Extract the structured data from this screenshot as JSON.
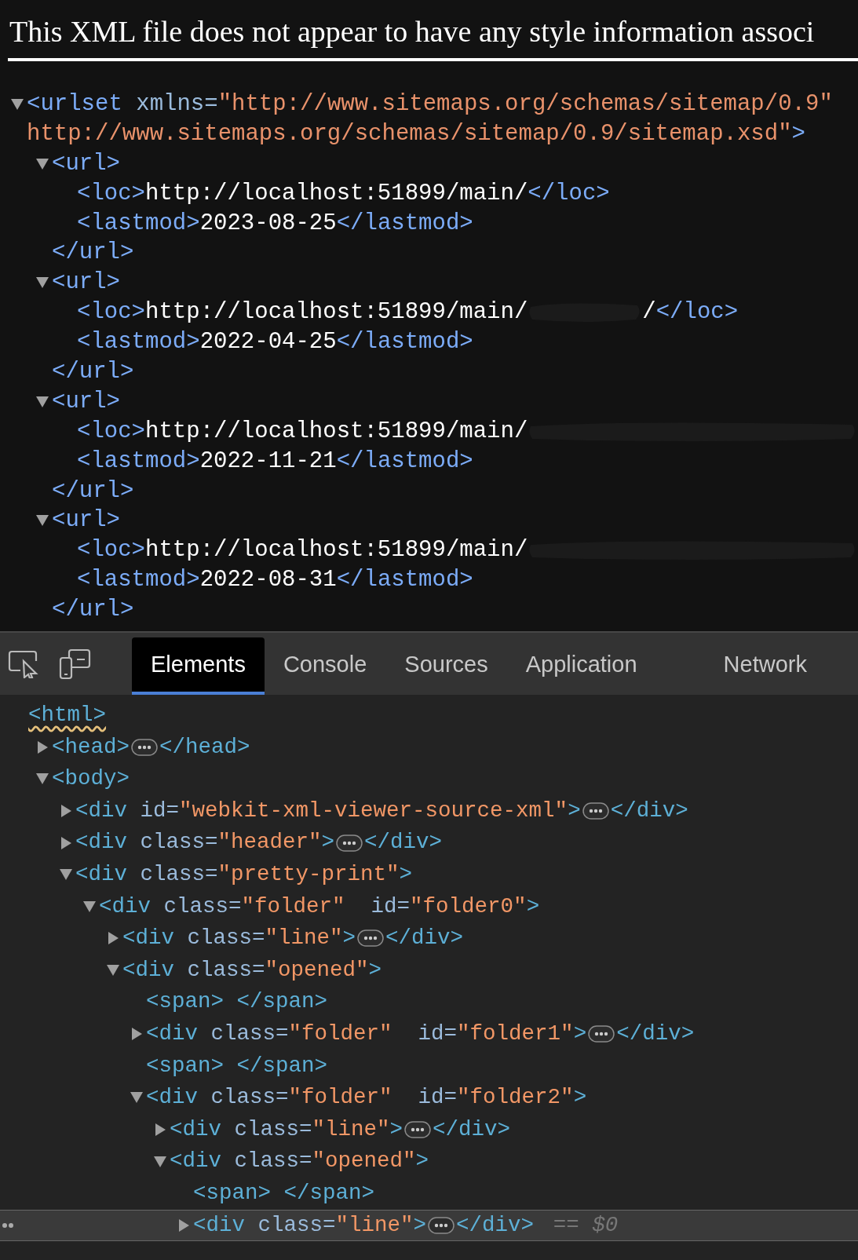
{
  "xml_viewer": {
    "notice": "This XML file does not appear to have any style information associ",
    "tree": {
      "expanded": true,
      "open": [
        {
          "kind": "tag",
          "text": "<urlset"
        },
        {
          "kind": "attr",
          "text": " xmlns="
        },
        {
          "kind": "value",
          "text": "\"http://www.sitemaps.org/schemas/sitemap/0.9\""
        }
      ],
      "open_continued": [
        {
          "kind": "value",
          "text": "http://www.sitemaps.org/schemas/sitemap/0.9/sitemap.xsd\""
        },
        {
          "kind": "tag",
          "text": ">"
        }
      ],
      "children": [
        {
          "expanded": true,
          "open": [
            {
              "kind": "tag",
              "text": "<url>"
            }
          ],
          "close": [
            {
              "kind": "tag",
              "text": "</url>"
            }
          ],
          "children": [
            {
              "open": [
                {
                  "kind": "tag",
                  "text": "<loc>"
                },
                {
                  "kind": "text",
                  "text": "http://localhost:51899/main/"
                },
                {
                  "kind": "tag",
                  "text": "</loc>"
                }
              ]
            },
            {
              "open": [
                {
                  "kind": "tag",
                  "text": "<lastmod>"
                },
                {
                  "kind": "text",
                  "text": "2023-08-25"
                },
                {
                  "kind": "tag",
                  "text": "</lastmod>"
                }
              ]
            }
          ]
        },
        {
          "expanded": true,
          "open": [
            {
              "kind": "tag",
              "text": "<url>"
            }
          ],
          "close": [
            {
              "kind": "tag",
              "text": "</url>"
            }
          ],
          "children": [
            {
              "open": [
                {
                  "kind": "tag",
                  "text": "<loc>"
                },
                {
                  "kind": "text",
                  "text": "http://localhost:51899/main/"
                },
                {
                  "kind": "redacted"
                },
                {
                  "kind": "text",
                  "text": "/"
                },
                {
                  "kind": "tag",
                  "text": "</loc>"
                }
              ]
            },
            {
              "open": [
                {
                  "kind": "tag",
                  "text": "<lastmod>"
                },
                {
                  "kind": "text",
                  "text": "2022-04-25"
                },
                {
                  "kind": "tag",
                  "text": "</lastmod>"
                }
              ]
            }
          ]
        },
        {
          "expanded": true,
          "open": [
            {
              "kind": "tag",
              "text": "<url>"
            }
          ],
          "close": [
            {
              "kind": "tag",
              "text": "</url>"
            }
          ],
          "children": [
            {
              "open": [
                {
                  "kind": "tag",
                  "text": "<loc>"
                },
                {
                  "kind": "text",
                  "text": "http://localhost:51899/main/"
                },
                {
                  "kind": "redacted"
                }
              ]
            },
            {
              "open": [
                {
                  "kind": "tag",
                  "text": "<lastmod>"
                },
                {
                  "kind": "text",
                  "text": "2022-11-21"
                },
                {
                  "kind": "tag",
                  "text": "</lastmod>"
                }
              ]
            }
          ]
        },
        {
          "expanded": true,
          "open": [
            {
              "kind": "tag",
              "text": "<url>"
            }
          ],
          "close": [
            {
              "kind": "tag",
              "text": "</url>"
            }
          ],
          "children": [
            {
              "open": [
                {
                  "kind": "tag",
                  "text": "<loc>"
                },
                {
                  "kind": "text",
                  "text": "http://localhost:51899/main/"
                },
                {
                  "kind": "redacted"
                }
              ]
            },
            {
              "open": [
                {
                  "kind": "tag",
                  "text": "<lastmod>"
                },
                {
                  "kind": "text",
                  "text": "2022-08-31"
                },
                {
                  "kind": "tag",
                  "text": "</lastmod>"
                }
              ]
            }
          ]
        }
      ]
    }
  },
  "devtools": {
    "tabs": [
      {
        "label": "Elements",
        "selected": true
      },
      {
        "label": "Console",
        "selected": false
      },
      {
        "label": "Sources",
        "selected": false
      },
      {
        "label": "Application",
        "selected": false
      },
      {
        "label": "Network",
        "selected": false
      }
    ],
    "tree": {
      "warning": true,
      "open": [
        {
          "kind": "tag",
          "text": "<html>"
        }
      ],
      "children": [
        {
          "expanded": false,
          "open": [
            {
              "kind": "tag",
              "text": "<head>"
            },
            {
              "kind": "ellipsis"
            },
            {
              "kind": "tag",
              "text": "</head>"
            }
          ]
        },
        {
          "expanded": true,
          "open": [
            {
              "kind": "tag",
              "text": "<body>"
            }
          ],
          "children": [
            {
              "expanded": false,
              "open": [
                {
                  "kind": "tag",
                  "text": "<div"
                },
                {
                  "kind": "attr",
                  "text": " id="
                },
                {
                  "kind": "value",
                  "text": "\"webkit-xml-viewer-source-xml\""
                },
                {
                  "kind": "tag",
                  "text": ">"
                },
                {
                  "kind": "ellipsis"
                },
                {
                  "kind": "tag",
                  "text": "</div>"
                }
              ]
            },
            {
              "expanded": false,
              "open": [
                {
                  "kind": "tag",
                  "text": "<div"
                },
                {
                  "kind": "attr",
                  "text": " class="
                },
                {
                  "kind": "value",
                  "text": "\"header\""
                },
                {
                  "kind": "tag",
                  "text": ">"
                },
                {
                  "kind": "ellipsis"
                },
                {
                  "kind": "tag",
                  "text": "</div>"
                }
              ]
            },
            {
              "expanded": true,
              "open": [
                {
                  "kind": "tag",
                  "text": "<div"
                },
                {
                  "kind": "attr",
                  "text": " class="
                },
                {
                  "kind": "value",
                  "text": "\"pretty-print\""
                },
                {
                  "kind": "tag",
                  "text": ">"
                }
              ],
              "children": [
                {
                  "expanded": true,
                  "open": [
                    {
                      "kind": "tag",
                      "text": "<div"
                    },
                    {
                      "kind": "attr",
                      "text": " class="
                    },
                    {
                      "kind": "value",
                      "text": "\"folder\""
                    },
                    {
                      "kind": "attr",
                      "text": "  id="
                    },
                    {
                      "kind": "value",
                      "text": "\"folder0\""
                    },
                    {
                      "kind": "tag",
                      "text": ">"
                    }
                  ],
                  "children": [
                    {
                      "expanded": false,
                      "open": [
                        {
                          "kind": "tag",
                          "text": "<div"
                        },
                        {
                          "kind": "attr",
                          "text": " class="
                        },
                        {
                          "kind": "value",
                          "text": "\"line\""
                        },
                        {
                          "kind": "tag",
                          "text": ">"
                        },
                        {
                          "kind": "ellipsis"
                        },
                        {
                          "kind": "tag",
                          "text": "</div>"
                        }
                      ]
                    },
                    {
                      "expanded": true,
                      "open": [
                        {
                          "kind": "tag",
                          "text": "<div"
                        },
                        {
                          "kind": "attr",
                          "text": " class="
                        },
                        {
                          "kind": "value",
                          "text": "\"opened\""
                        },
                        {
                          "kind": "tag",
                          "text": ">"
                        }
                      ],
                      "children": [
                        {
                          "open": [
                            {
                              "kind": "tag",
                              "text": "<span> </span>"
                            }
                          ]
                        },
                        {
                          "expanded": false,
                          "open": [
                            {
                              "kind": "tag",
                              "text": "<div"
                            },
                            {
                              "kind": "attr",
                              "text": " class="
                            },
                            {
                              "kind": "value",
                              "text": "\"folder\""
                            },
                            {
                              "kind": "attr",
                              "text": "  id="
                            },
                            {
                              "kind": "value",
                              "text": "\"folder1\""
                            },
                            {
                              "kind": "tag",
                              "text": ">"
                            },
                            {
                              "kind": "ellipsis"
                            },
                            {
                              "kind": "tag",
                              "text": "</div>"
                            }
                          ]
                        },
                        {
                          "open": [
                            {
                              "kind": "tag",
                              "text": "<span> </span>"
                            }
                          ]
                        },
                        {
                          "expanded": true,
                          "open": [
                            {
                              "kind": "tag",
                              "text": "<div"
                            },
                            {
                              "kind": "attr",
                              "text": " class="
                            },
                            {
                              "kind": "value",
                              "text": "\"folder\""
                            },
                            {
                              "kind": "attr",
                              "text": "  id="
                            },
                            {
                              "kind": "value",
                              "text": "\"folder2\""
                            },
                            {
                              "kind": "tag",
                              "text": ">"
                            }
                          ],
                          "children": [
                            {
                              "expanded": false,
                              "open": [
                                {
                                  "kind": "tag",
                                  "text": "<div"
                                },
                                {
                                  "kind": "attr",
                                  "text": " class="
                                },
                                {
                                  "kind": "value",
                                  "text": "\"line\""
                                },
                                {
                                  "kind": "tag",
                                  "text": ">"
                                },
                                {
                                  "kind": "ellipsis"
                                },
                                {
                                  "kind": "tag",
                                  "text": "</div>"
                                }
                              ]
                            },
                            {
                              "expanded": true,
                              "open": [
                                {
                                  "kind": "tag",
                                  "text": "<div"
                                },
                                {
                                  "kind": "attr",
                                  "text": " class="
                                },
                                {
                                  "kind": "value",
                                  "text": "\"opened\""
                                },
                                {
                                  "kind": "tag",
                                  "text": ">"
                                }
                              ],
                              "children": [
                                {
                                  "open": [
                                    {
                                      "kind": "tag",
                                      "text": "<span> </span>"
                                    }
                                  ]
                                },
                                {
                                  "expanded": false,
                                  "selected": true,
                                  "open": [
                                    {
                                      "kind": "tag",
                                      "text": "<div"
                                    },
                                    {
                                      "kind": "attr",
                                      "text": " class="
                                    },
                                    {
                                      "kind": "value",
                                      "text": "\"line\""
                                    },
                                    {
                                      "kind": "tag",
                                      "text": ">"
                                    },
                                    {
                                      "kind": "ellipsis"
                                    },
                                    {
                                      "kind": "tag",
                                      "text": "</div>"
                                    },
                                    {
                                      "kind": "meta",
                                      "text": " == $0"
                                    }
                                  ]
                                }
                              ]
                            }
                          ]
                        }
                      ]
                    }
                  ]
                }
              ]
            }
          ]
        }
      ]
    }
  }
}
